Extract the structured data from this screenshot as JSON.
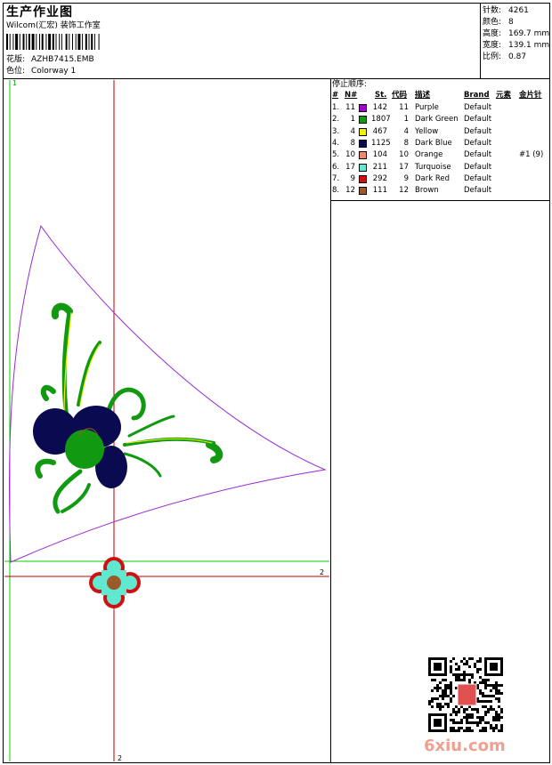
{
  "header": {
    "title": "生产作业图",
    "company": "Wilcom(汇宏) 装饰工作室",
    "design_label": "花版:",
    "design_value": "AZHB7415.EMB",
    "colorway_label": "色位:",
    "colorway_value": "Colorway 1"
  },
  "stats": [
    {
      "label": "针数:",
      "value": "4261"
    },
    {
      "label": "颜色:",
      "value": "8"
    },
    {
      "label": "高度:",
      "value": "169.7 mm"
    },
    {
      "label": "宽度:",
      "value": "139.1 mm"
    },
    {
      "label": "比例:",
      "value": "0.87"
    }
  ],
  "stop_sequence": {
    "title": "停止顺序:",
    "headers": {
      "num": "#",
      "n": "N#",
      "st": "St.",
      "code": "代码",
      "desc": "描述",
      "brand": "Brand",
      "element": "元素",
      "sequin": "金片针"
    },
    "rows": [
      {
        "num": "1.",
        "n": "11",
        "color": "#a000c8",
        "st": "142",
        "code": "11",
        "desc": "Purple",
        "brand": "Default",
        "sequin": ""
      },
      {
        "num": "2.",
        "n": "1",
        "color": "#119a11",
        "st": "1807",
        "code": "1",
        "desc": "Dark Green",
        "brand": "Default",
        "sequin": ""
      },
      {
        "num": "3.",
        "n": "4",
        "color": "#f0f000",
        "st": "467",
        "code": "4",
        "desc": "Yellow",
        "brand": "Default",
        "sequin": ""
      },
      {
        "num": "4.",
        "n": "8",
        "color": "#0a0a50",
        "st": "1125",
        "code": "8",
        "desc": "Dark Blue",
        "brand": "Default",
        "sequin": ""
      },
      {
        "num": "5.",
        "n": "10",
        "color": "#f08a6a",
        "st": "104",
        "code": "10",
        "desc": "Orange",
        "brand": "Default",
        "sequin": "#1 (9)"
      },
      {
        "num": "6.",
        "n": "17",
        "color": "#60e8d0",
        "st": "211",
        "code": "17",
        "desc": "Turquoise",
        "brand": "Default",
        "sequin": ""
      },
      {
        "num": "7.",
        "n": "9",
        "color": "#d01010",
        "st": "292",
        "code": "9",
        "desc": "Dark Red",
        "brand": "Default",
        "sequin": ""
      },
      {
        "num": "8.",
        "n": "12",
        "color": "#9a5a2a",
        "st": "111",
        "code": "12",
        "desc": "Brown",
        "brand": "Default",
        "sequin": ""
      }
    ]
  },
  "guides": {
    "v1": "1",
    "h2": "2",
    "v2": "2"
  },
  "watermark": "6xiu.com",
  "colors": {
    "guide_green": "#00d000",
    "guide_red": "#c00000",
    "outline": "#9a2ad0"
  }
}
